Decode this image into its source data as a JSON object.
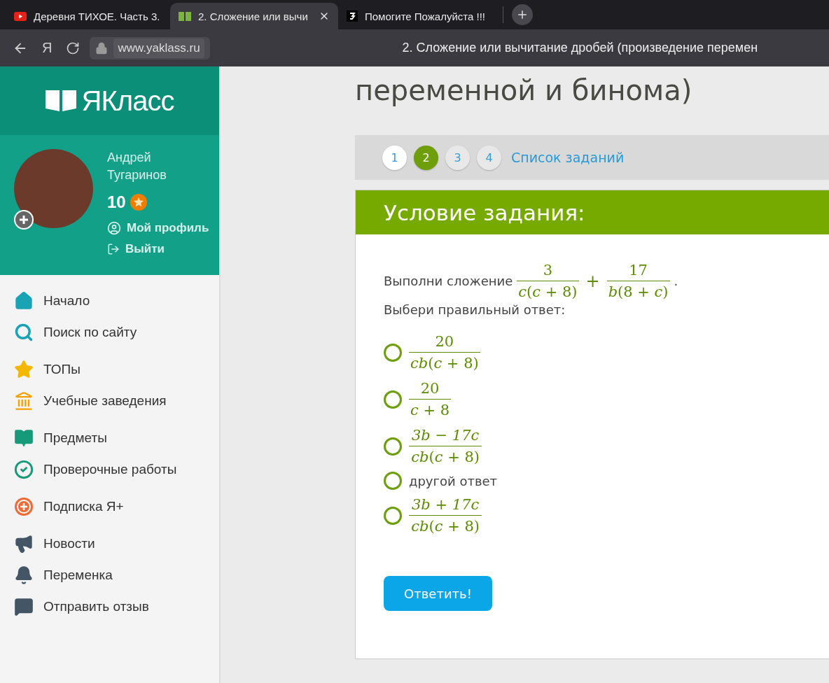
{
  "browser": {
    "tabs": [
      {
        "title": "Деревня ТИХОЕ. Часть 3.",
        "kind": "video",
        "selected": false
      },
      {
        "title": "2. Сложение или вычи",
        "kind": "book",
        "selected": true
      },
      {
        "title": "Помогите Пожалуйста !!!",
        "kind": "qa",
        "selected": false
      }
    ],
    "yandex_button": "Я",
    "url": "www.yaklass.ru",
    "page_title": "2. Сложение или вычитание дробей (произведение перемен"
  },
  "sidebar": {
    "logo": "ЯКласс",
    "user": {
      "name": "Андрей Тугаринов",
      "points": "10",
      "links": [
        {
          "label": "Мой профиль",
          "kind": "profile"
        },
        {
          "label": "Выйти",
          "kind": "logout"
        }
      ]
    },
    "menu": [
      [
        {
          "label": "Начало",
          "kind": "home"
        },
        {
          "label": "Поиск по сайту",
          "kind": "search"
        }
      ],
      [
        {
          "label": "ТОПы",
          "kind": "star"
        },
        {
          "label": "Учебные заведения",
          "kind": "school"
        }
      ],
      [
        {
          "label": "Предметы",
          "kind": "subjects"
        },
        {
          "label": "Проверочные работы",
          "kind": "check"
        }
      ],
      [
        {
          "label": "Подписка Я+",
          "kind": "plus"
        }
      ],
      [
        {
          "label": "Новости",
          "kind": "news"
        },
        {
          "label": "Переменка",
          "kind": "bell"
        },
        {
          "label": "Отправить отзыв",
          "kind": "feedback"
        }
      ]
    ]
  },
  "main": {
    "title": "переменной и бинома)",
    "pager": {
      "steps": [
        {
          "label": "1",
          "selected": false,
          "visited": true
        },
        {
          "label": "2",
          "selected": true,
          "visited": true
        },
        {
          "label": "3",
          "selected": false,
          "visited": false
        },
        {
          "label": "4",
          "selected": false,
          "visited": false
        }
      ],
      "list_link": "Список заданий"
    },
    "task": {
      "header": "Условие задания:",
      "prompt": "Выполни сложение",
      "expression": [
        {
          "num": "3",
          "den": "*c*(*c* + 8)"
        },
        {
          "op": "+"
        },
        {
          "num": "17",
          "den": "*b*(8 + *c*)"
        }
      ],
      "end": ".",
      "question": "Выбери правильный ответ:",
      "options": [
        {
          "kind": "fraction",
          "num": "20",
          "den": "*cb*(*c* + 8)",
          "selected": false
        },
        {
          "kind": "fraction",
          "num": "20",
          "den": "*c* + 8",
          "selected": false
        },
        {
          "kind": "fraction",
          "num": "*3b* − *17c*",
          "den": "*cb*(*c* + 8)",
          "selected": false
        },
        {
          "kind": "text",
          "text": "другой ответ",
          "selected": false
        },
        {
          "kind": "fraction",
          "num": "*3b* + *17c*",
          "den": "*cb*(*c* + 8)",
          "selected": false
        }
      ],
      "submit": "Ответить!"
    }
  }
}
